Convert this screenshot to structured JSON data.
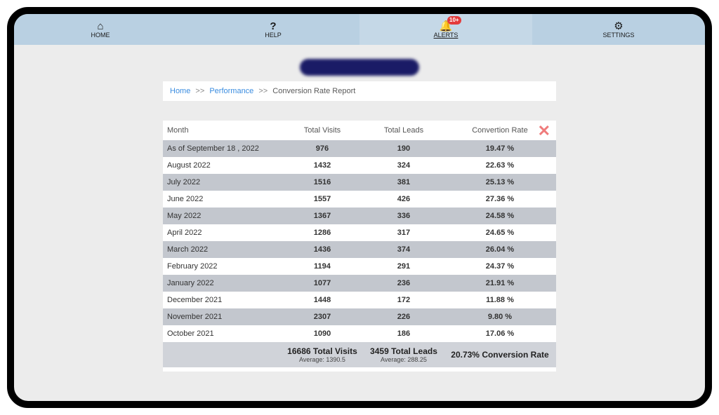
{
  "nav": {
    "home": "HOME",
    "help": "HELP",
    "alerts": "ALERTS",
    "alerts_badge": "10+",
    "settings": "SETTINGS"
  },
  "breadcrumb": {
    "home": "Home",
    "performance": "Performance",
    "current": "Conversion Rate Report",
    "sep": ">>"
  },
  "table": {
    "headers": {
      "month": "Month",
      "visits": "Total Visits",
      "leads": "Total Leads",
      "rate": "Convertion Rate"
    },
    "rows": [
      {
        "month": "As of September 18 , 2022",
        "visits": "976",
        "leads": "190",
        "rate": "19.47 %"
      },
      {
        "month": "August 2022",
        "visits": "1432",
        "leads": "324",
        "rate": "22.63 %"
      },
      {
        "month": "July 2022",
        "visits": "1516",
        "leads": "381",
        "rate": "25.13 %"
      },
      {
        "month": "June 2022",
        "visits": "1557",
        "leads": "426",
        "rate": "27.36 %"
      },
      {
        "month": "May 2022",
        "visits": "1367",
        "leads": "336",
        "rate": "24.58 %"
      },
      {
        "month": "April 2022",
        "visits": "1286",
        "leads": "317",
        "rate": "24.65 %"
      },
      {
        "month": "March 2022",
        "visits": "1436",
        "leads": "374",
        "rate": "26.04 %"
      },
      {
        "month": "February 2022",
        "visits": "1194",
        "leads": "291",
        "rate": "24.37 %"
      },
      {
        "month": "January 2022",
        "visits": "1077",
        "leads": "236",
        "rate": "21.91 %"
      },
      {
        "month": "December 2021",
        "visits": "1448",
        "leads": "172",
        "rate": "11.88 %"
      },
      {
        "month": "November 2021",
        "visits": "2307",
        "leads": "226",
        "rate": "9.80 %"
      },
      {
        "month": "October 2021",
        "visits": "1090",
        "leads": "186",
        "rate": "17.06 %"
      }
    ],
    "footer": {
      "visits_total": "16686 Total Visits",
      "visits_avg": "Average: 1390.5",
      "leads_total": "3459 Total Leads",
      "leads_avg": "Average: 288.25",
      "rate_total": "20.73% Conversion Rate"
    }
  },
  "close": "✕"
}
